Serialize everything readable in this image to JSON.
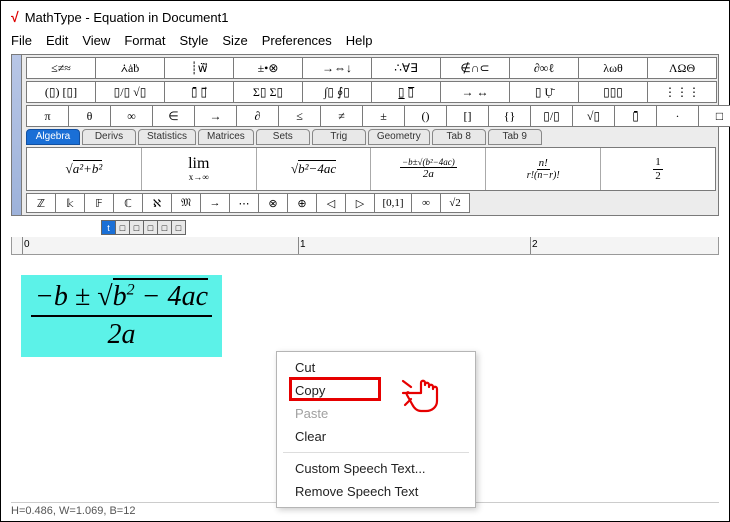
{
  "title": {
    "icon": "√",
    "text": "MathType - Equation in Document1"
  },
  "menu": [
    "File",
    "Edit",
    "View",
    "Format",
    "Style",
    "Size",
    "Preferences",
    "Help"
  ],
  "tool_rows": [
    [
      "≤≠≈",
      "⩑ȧḃ",
      "┊ẅ⃗",
      "±•⊗",
      "→⇔↓",
      "∴∀∃",
      "∉∩⊂",
      "∂∞ℓ",
      "λωθ",
      "ΛΩΘ"
    ],
    [
      "(▯) [▯]",
      "▯/▯ √▯",
      "▯̄ ▯⃗",
      "Σ▯ Σ▯",
      "∫▯ ∮▯",
      "▯̲ ▯̅",
      "→ ↔",
      "▯ Ụ̄",
      "▯▯▯",
      "⋮⋮⋮"
    ],
    [
      "π",
      "θ",
      "∞",
      "∈",
      "→",
      "∂",
      "≤",
      "≠",
      "±",
      "()",
      "[]",
      "{}",
      "▯/▯",
      "√▯",
      "▯̄",
      "·",
      "□"
    ]
  ],
  "tabs": [
    "Algebra",
    "Derivs",
    "Statistics",
    "Matrices",
    "Sets",
    "Trig",
    "Geometry",
    "Tab 8",
    "Tab 9"
  ],
  "active_tab": 0,
  "templates": [
    {
      "type": "sqrt",
      "tex": "√(a²+b²)"
    },
    {
      "type": "lim",
      "top": "lim",
      "bot": "x→∞"
    },
    {
      "type": "sqrt",
      "tex": "√(b²−4ac)"
    },
    {
      "type": "frac",
      "num": "−b±√(b²−4ac)",
      "den": "2a"
    },
    {
      "type": "frac",
      "num": "n!",
      "den": "r!(n−r)!"
    },
    {
      "type": "frac",
      "num": "1",
      "den": "2"
    }
  ],
  "small_row": [
    "ℤ",
    "𝕜",
    "𝔽",
    "ℂ",
    "ℵ",
    "𝔐",
    "→",
    "⋯",
    "⊗",
    "⊕",
    "◁",
    "▷",
    "[0,1]",
    "∞",
    "√2"
  ],
  "tiny_row": [
    "t",
    "□",
    "□",
    "□",
    "□",
    "□"
  ],
  "ruler": [
    "0",
    "1",
    "2"
  ],
  "equation": {
    "num": "−b ± √(b² − 4ac)",
    "den": "2a"
  },
  "context_menu": {
    "items": [
      {
        "label": "Cut",
        "enabled": true
      },
      {
        "label": "Copy",
        "enabled": true,
        "highlight": true
      },
      {
        "label": "Paste",
        "enabled": false
      },
      {
        "label": "Clear",
        "enabled": true
      },
      {
        "sep": true
      },
      {
        "label": "Custom Speech Text...",
        "enabled": true
      },
      {
        "label": "Remove Speech Text",
        "enabled": true
      }
    ]
  },
  "status": "H=0.486, W=1.069, B=12"
}
